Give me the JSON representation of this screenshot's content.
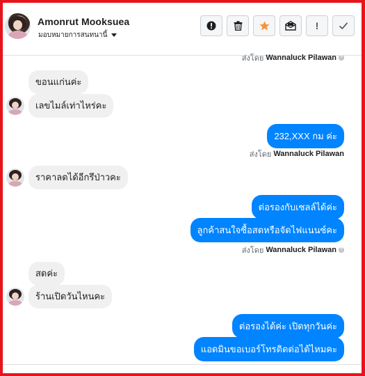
{
  "header": {
    "contact_name": "Amonrut Mooksuea",
    "assign_label": "มอบหมายการสนทนานี้",
    "toolbar": [
      {
        "id": "report",
        "icon": "alert-circle-icon",
        "label": ""
      },
      {
        "id": "delete",
        "icon": "trash-icon",
        "label": ""
      },
      {
        "id": "star",
        "icon": "star-icon",
        "label": "",
        "color": "#f7923b"
      },
      {
        "id": "mark-unread",
        "icon": "envelope-icon",
        "label": ""
      },
      {
        "id": "spam",
        "icon": "exclamation-icon",
        "label": "!"
      },
      {
        "id": "done",
        "icon": "check-icon",
        "label": ""
      }
    ]
  },
  "conversation": {
    "sent_by_prefix": "ส่งโดย",
    "sender_name": "Wannaluck Pilawan",
    "messages": [
      {
        "dir": "in",
        "text": "ขอนแก่นค่ะ"
      },
      {
        "dir": "in",
        "text": "เลขไมล์เท่าไหร่คะ"
      },
      {
        "dir": "out",
        "text": "232,XXX  กม ค่ะ"
      },
      {
        "dir": "in",
        "text": "ราคาลดได้อีกรึป่าวคะ"
      },
      {
        "dir": "out",
        "text": "ต่อรองกับเซลล์ได้ค่ะ"
      },
      {
        "dir": "out",
        "text": "ลูกค้าสนใจซื้อสดหรือจัดไฟแนนซ์คะ"
      },
      {
        "dir": "in",
        "text": "สดค่ะ"
      },
      {
        "dir": "in",
        "text": "ร้านเปิดวันไหนคะ"
      },
      {
        "dir": "out",
        "text": "ต่อรองได้ค่ะ เปิดทุกวันค่ะ"
      },
      {
        "dir": "out",
        "text": "แอดมินขอเบอร์โทรติดต่อได้ไหมคะ"
      }
    ]
  },
  "colors": {
    "outgoing_bubble": "#0084ff",
    "incoming_bubble": "#f1f0f0",
    "frame_border": "#e8141b"
  }
}
